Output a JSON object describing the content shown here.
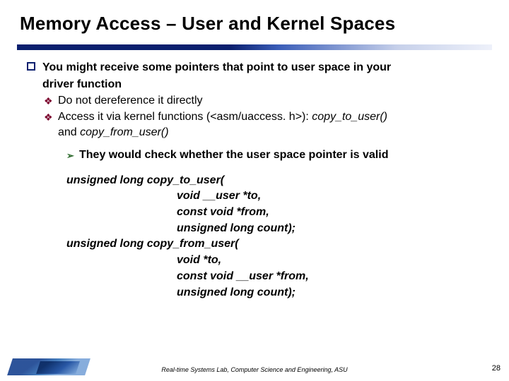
{
  "title": "Memory Access – User and Kernel Spaces",
  "bullets": {
    "l1_a": "You might receive some pointers that point to user space in your",
    "l1_b": "driver function",
    "l2_a": "Do not dereference it directly",
    "l2_b1": "Access it via kernel functions (<asm/uaccess. h>): ",
    "l2_b1_em1": "copy_to_user()",
    "l2_b2_a": "and ",
    "l2_b2_em": "copy_from_user()",
    "l3": "They would check whether the user space pointer is valid"
  },
  "code": {
    "c1": "unsigned long copy_to_user(",
    "c2": "void __user *to,",
    "c3": "const void *from,",
    "c4": "unsigned long count);",
    "c5": "unsigned long copy_from_user(",
    "c6": "void *to,",
    "c7": "const void __user *from,",
    "c8": "unsigned long count);"
  },
  "footer": "Real-time Systems Lab, Computer Science and Engineering, ASU",
  "page": "28"
}
